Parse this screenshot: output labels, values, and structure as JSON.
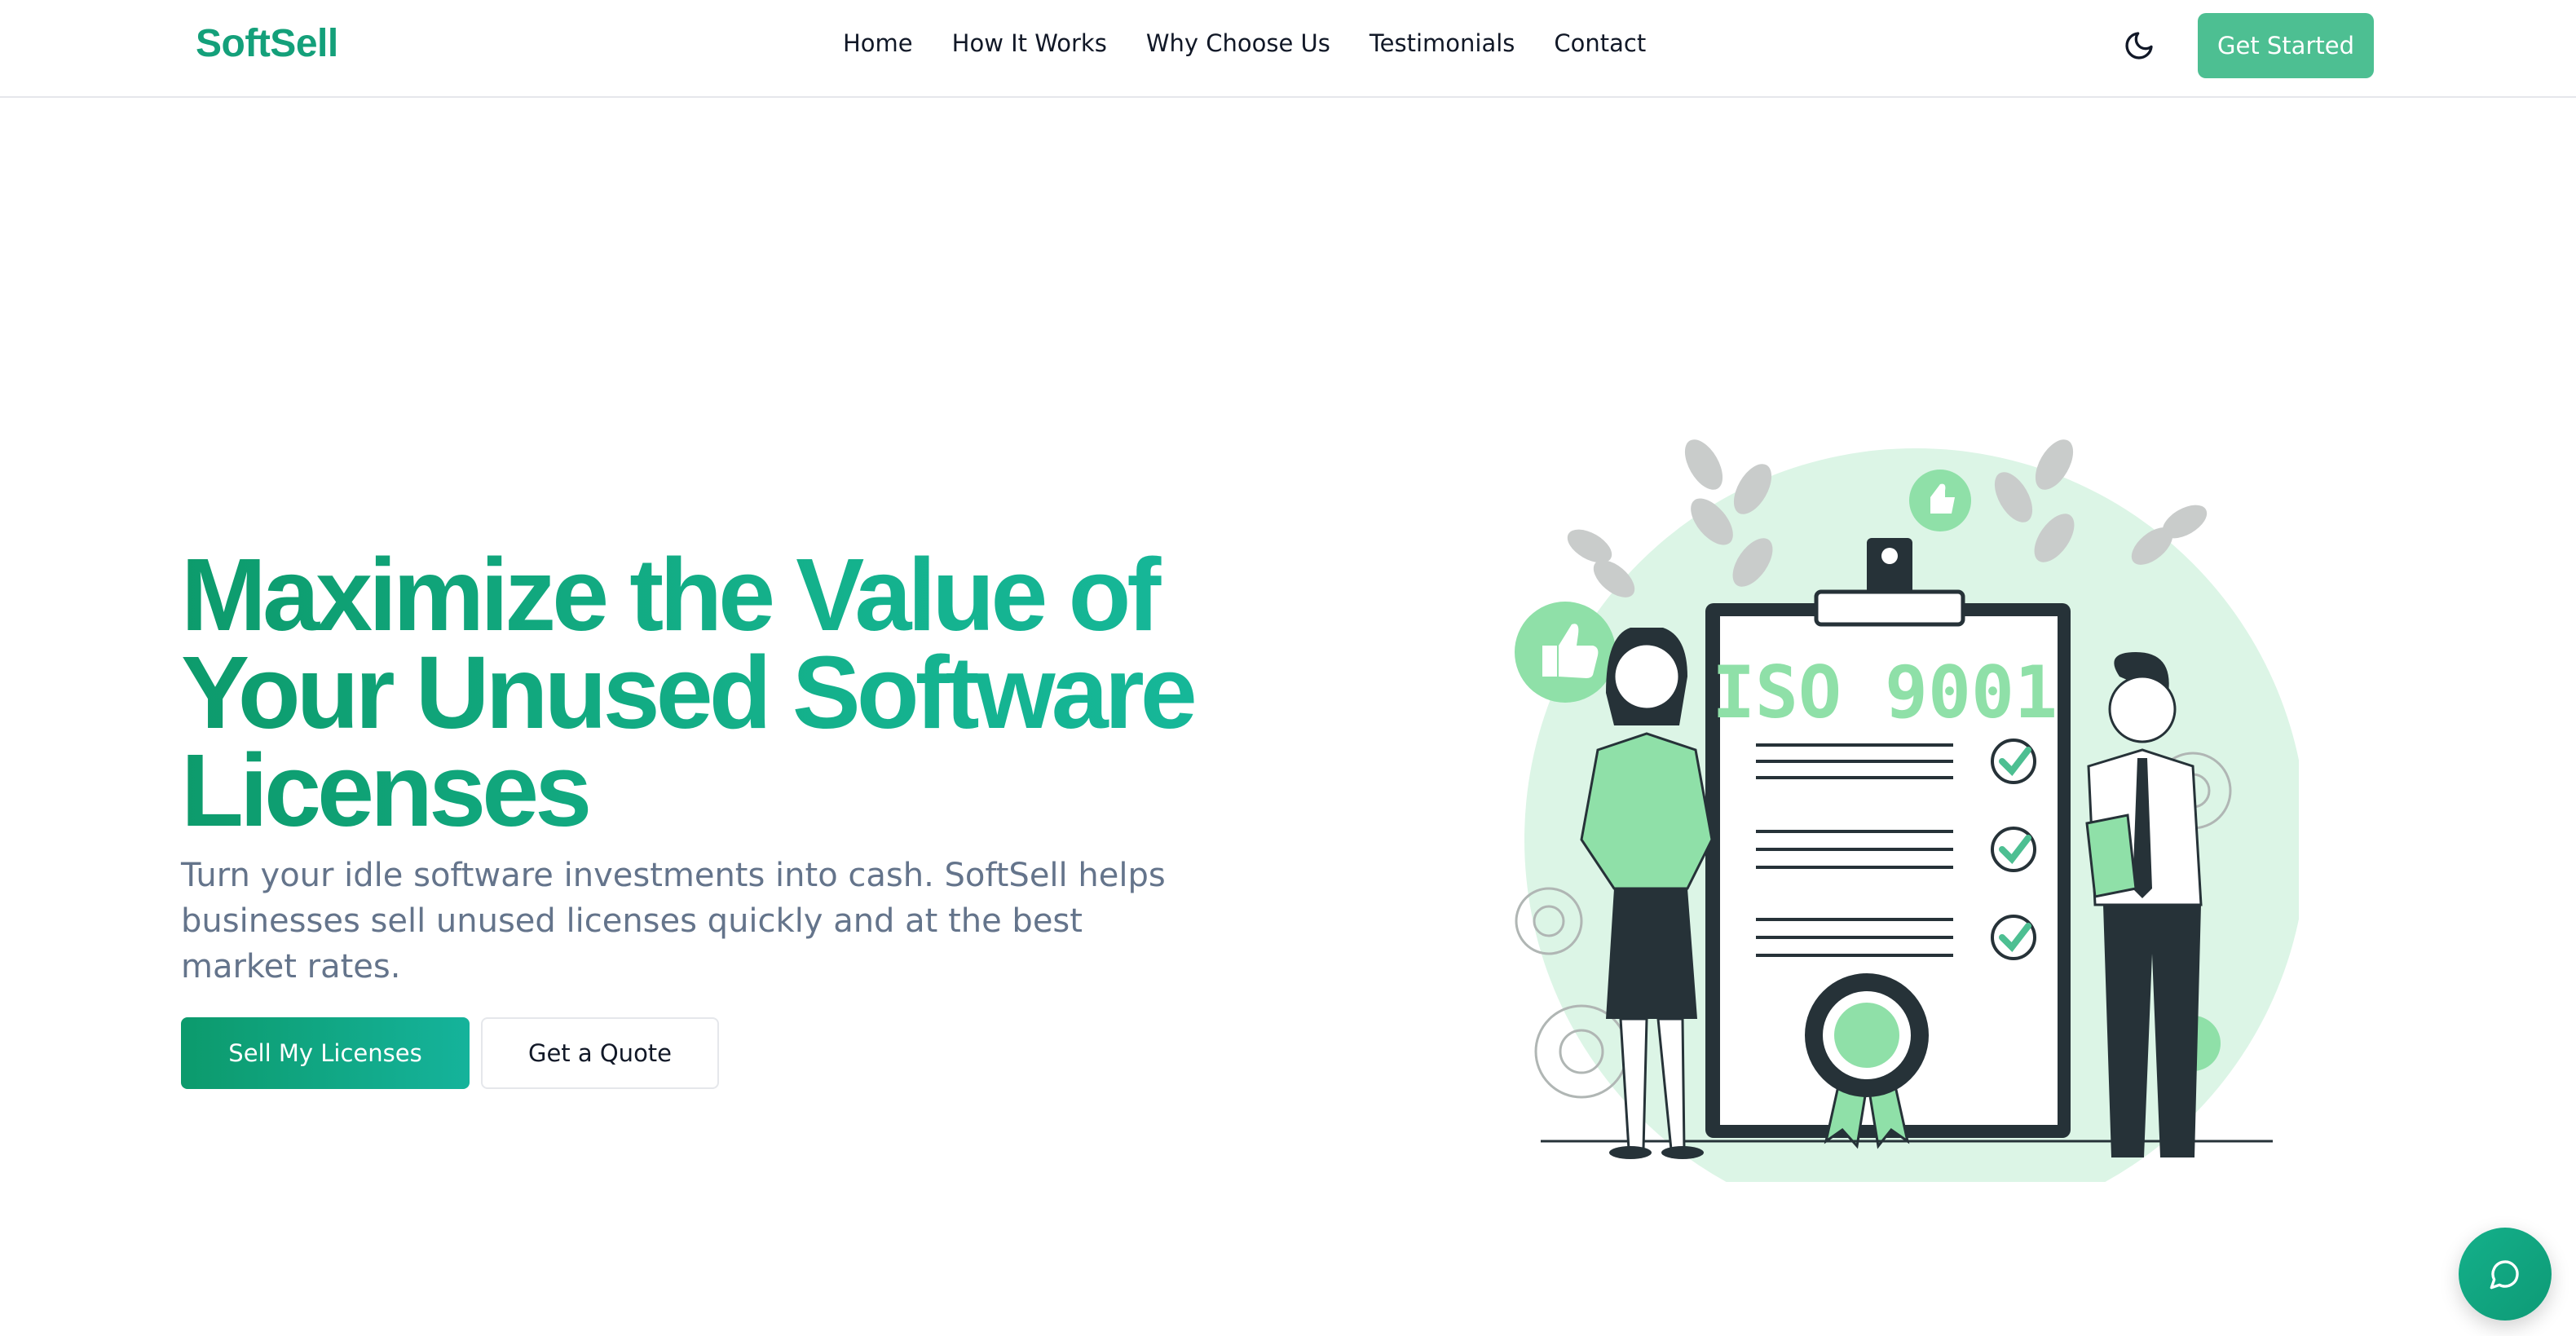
{
  "header": {
    "logo": "SoftSell",
    "nav": [
      "Home",
      "How It Works",
      "Why Choose Us",
      "Testimonials",
      "Contact"
    ],
    "theme_icon": "moon-icon",
    "cta_label": "Get Started"
  },
  "hero": {
    "title_lines": [
      "Maximize the Value of",
      "Your Unused Software",
      "Licenses"
    ],
    "subtitle": "Turn your idle software investments into cash. SoftSell helps businesses sell unused licenses quickly and at the best market rates.",
    "primary_button": "Sell My Licenses",
    "secondary_button": "Get a Quote"
  },
  "illustration": {
    "badge_text": "ISO 9001",
    "icons": [
      "thumbs-up-icon",
      "check-icon",
      "gear-icon",
      "award-ribbon-icon",
      "leaf-icon"
    ]
  },
  "chat": {
    "icon": "chat-bubble-icon"
  },
  "colors": {
    "brand": "#14a07a",
    "accent_light": "#dcf5e6",
    "dark": "#263238",
    "button_top": "#4dbf92"
  }
}
